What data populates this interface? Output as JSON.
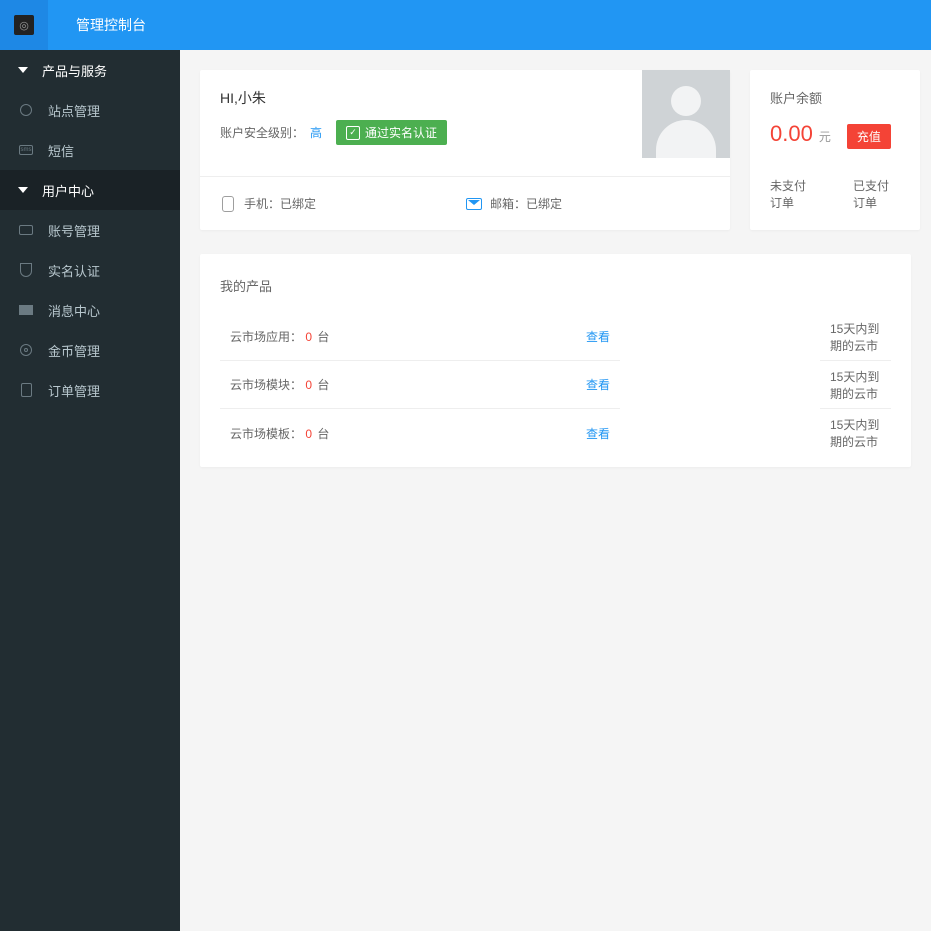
{
  "header": {
    "title": "管理控制台"
  },
  "sidebar": {
    "groups": [
      {
        "label": "产品与服务"
      },
      {
        "label": "用户中心"
      }
    ],
    "items_products": [
      {
        "label": "站点管理"
      },
      {
        "label": "短信"
      }
    ],
    "items_user": [
      {
        "label": "账号管理"
      },
      {
        "label": "实名认证"
      },
      {
        "label": "消息中心"
      },
      {
        "label": "金币管理"
      },
      {
        "label": "订单管理"
      }
    ]
  },
  "user_card": {
    "greeting": "HI,小朱",
    "security_label": "账户安全级别：",
    "security_level": "高",
    "verified_label": "通过实名认证",
    "phone_label": "手机：已绑定",
    "email_label": "邮箱：已绑定"
  },
  "balance_card": {
    "title": "账户余额",
    "amount": "0.00",
    "unit": "元",
    "recharge": "充值",
    "unpaid_label": "未支付订单",
    "paid_label": "已支付订单"
  },
  "products_card": {
    "title": "我的产品",
    "rows": [
      {
        "name": "云市场应用：",
        "count": "0",
        "unit": " 台",
        "view": "查看",
        "expire": "15天内到期的云市"
      },
      {
        "name": "云市场模块：",
        "count": "0",
        "unit": " 台",
        "view": "查看",
        "expire": "15天内到期的云市"
      },
      {
        "name": "云市场模板：",
        "count": "0",
        "unit": " 台",
        "view": "查看",
        "expire": "15天内到期的云市"
      }
    ]
  }
}
